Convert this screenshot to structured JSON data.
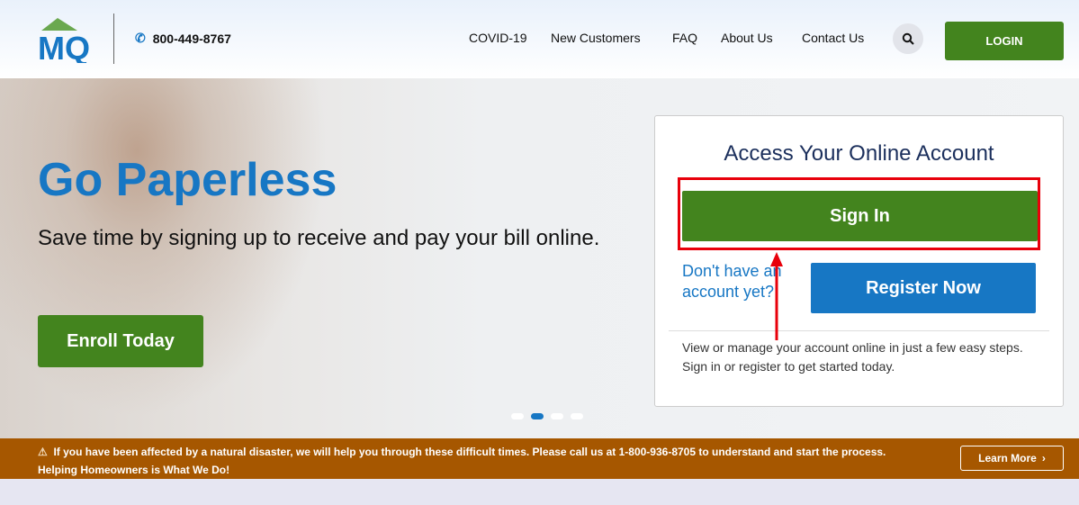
{
  "header": {
    "logo_text": "MQ",
    "phone": "800-449-8767",
    "nav": [
      "COVID-19",
      "New Customers",
      "FAQ",
      "About Us",
      "Contact Us"
    ],
    "login": "LOGIN"
  },
  "hero": {
    "title": "Go Paperless",
    "subtitle": "Save time by signing up to receive and pay your bill online.",
    "cta": "Enroll Today",
    "slides": 4,
    "active_slide": 2
  },
  "account": {
    "title": "Access Your Online Account",
    "sign_in": "Sign In",
    "no_account": "Don't have an account yet?",
    "register": "Register Now",
    "description": "View or manage your account online in just a few easy steps. Sign in or register to get started today."
  },
  "banner": {
    "text": "If you have been affected by a natural disaster, we will help you through these difficult times. Please call us at 1-800-936-8705 to understand and start the process. Helping Homeowners is What We Do!",
    "button": "Learn More"
  },
  "colors": {
    "green": "#43841e",
    "blue": "#1777c4",
    "banner": "#a65700",
    "highlight": "#e8000b"
  }
}
